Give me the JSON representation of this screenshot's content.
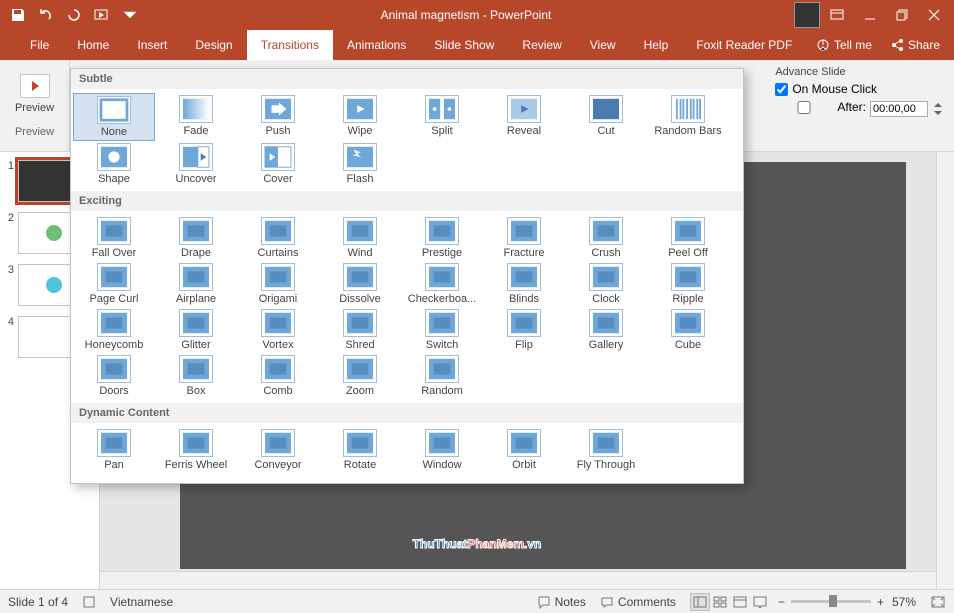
{
  "window": {
    "title": "Animal magnetism - PowerPoint"
  },
  "tabs": [
    "File",
    "Home",
    "Insert",
    "Design",
    "Transitions",
    "Animations",
    "Slide Show",
    "Review",
    "View",
    "Help",
    "Foxit Reader PDF"
  ],
  "active_tab": 4,
  "tellme": "Tell me",
  "share": "Share",
  "ribbon": {
    "preview": {
      "label": "Preview",
      "caption": "Preview"
    },
    "advance": {
      "header": "Advance Slide",
      "on_mouse_click": "On Mouse Click",
      "after_label": "After:",
      "after_value": "00:00,00",
      "on_mouse_click_checked": true,
      "after_checked": false
    }
  },
  "gallery": {
    "categories": [
      {
        "name": "Subtle",
        "items": [
          "None",
          "Fade",
          "Push",
          "Wipe",
          "Split",
          "Reveal",
          "Cut",
          "Random Bars",
          "Shape",
          "Uncover",
          "Cover",
          "Flash"
        ]
      },
      {
        "name": "Exciting",
        "items": [
          "Fall Over",
          "Drape",
          "Curtains",
          "Wind",
          "Prestige",
          "Fracture",
          "Crush",
          "Peel Off",
          "Page Curl",
          "Airplane",
          "Origami",
          "Dissolve",
          "Checkerboa...",
          "Blinds",
          "Clock",
          "Ripple",
          "Honeycomb",
          "Glitter",
          "Vortex",
          "Shred",
          "Switch",
          "Flip",
          "Gallery",
          "Cube",
          "Doors",
          "Box",
          "Comb",
          "Zoom",
          "Random"
        ]
      },
      {
        "name": "Dynamic Content",
        "items": [
          "Pan",
          "Ferris Wheel",
          "Conveyor",
          "Rotate",
          "Window",
          "Orbit",
          "Fly Through"
        ]
      }
    ],
    "selected": "None"
  },
  "slides": {
    "count": 4,
    "active": 1
  },
  "status": {
    "slide_text": "Slide 1 of 4",
    "language": "Vietnamese",
    "notes": "Notes",
    "comments": "Comments",
    "zoom": "57%"
  },
  "watermark": {
    "a": "ThuThuat",
    "b": "PhanMem",
    "c": ".vn"
  },
  "chart_data": null
}
